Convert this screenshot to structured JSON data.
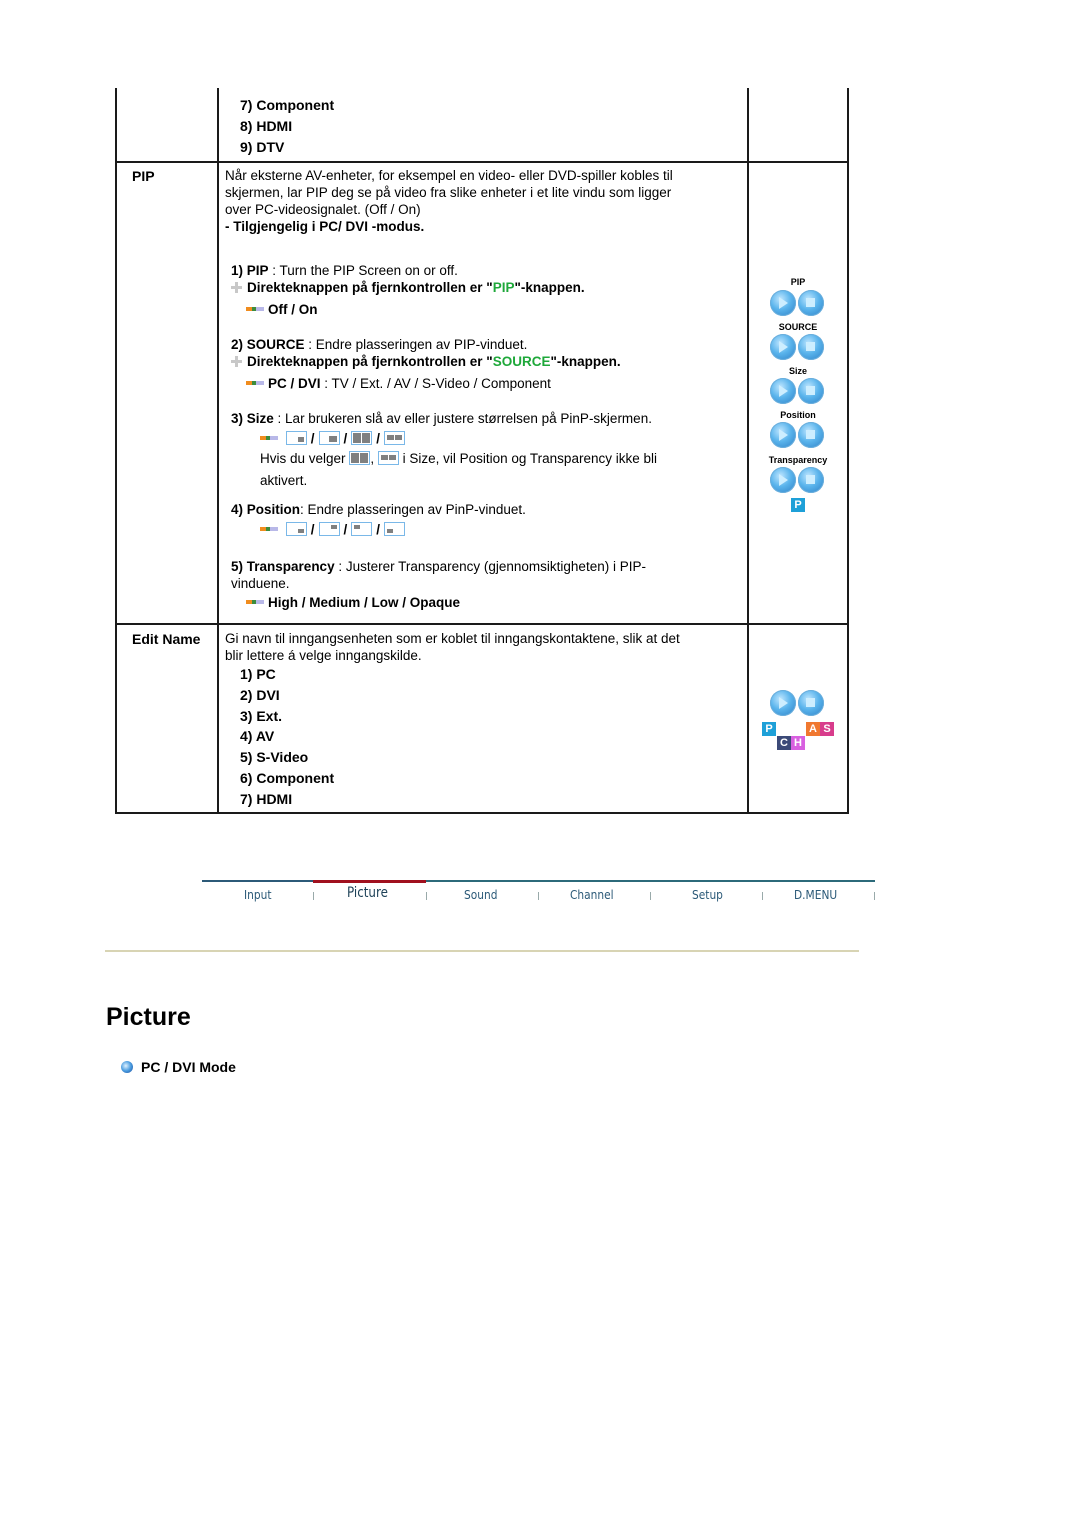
{
  "table": {
    "prev_items": [
      "7) Component",
      "8) HDMI",
      "9) DTV"
    ],
    "pip": {
      "label": "PIP",
      "desc_lines": [
        "Når eksterne AV-enheter, for eksempel en video- eller DVD-spiller kobles til",
        "skjermen, lar PIP deg se på video fra slike enheter i et lite vindu som ligger",
        "over PC-videosignalet. (Off / On)"
      ],
      "note": "- Tilgjengelig i PC/ DVI -modus.",
      "s1_num": "1)",
      "s1_key": "PIP",
      "s1_text": " : Turn the PIP Screen on or off.",
      "direct_pre": "Direkteknappen på fjernkontrollen er \"",
      "direct_pip_key": "PIP",
      "direct_post": "\"-knappen.",
      "s1_opts": "Off / On",
      "s2_num": "2)",
      "s2_key": "SOURCE",
      "s2_text": " : Endre plasseringen av PIP-vinduet.",
      "direct_source_key": "SOURCE",
      "s2_opts_key": "PC / DVI",
      "s2_opts_text": " : TV / Ext. / AV / S-Video / Component",
      "s3_num": "3)",
      "s3_key": "Size",
      "s3_text": " : Lar brukeren slå av eller justere størrelsen på PinP-skjermen.",
      "s3_note_pre": "Hvis du velger",
      "s3_note_comma": ",",
      "s3_note_post": "i Size, vil Position og Transparency ikke bli",
      "s3_note_line2": "aktivert.",
      "s4_num": "4)",
      "s4_key": "Position",
      "s4_text": ": Endre plasseringen av PinP-vinduet.",
      "s5_num": "5)",
      "s5_key": "Transparency",
      "s5_text": " : Justerer Transparency (gjennomsiktigheten) i PIP-",
      "s5_text2": "vinduene.",
      "s5_opts": "High / Medium / Low / Opaque",
      "slash": "/",
      "remote_labels": [
        "PIP",
        "SOURCE",
        "Size",
        "Position",
        "Transparency"
      ],
      "remote_p": "P"
    },
    "edit_name": {
      "label": "Edit Name",
      "desc_lines": [
        "Gi navn til inngangsenheten som er koblet til inngangskontaktene, slik at det",
        "blir lettere á velge inngangskilde."
      ],
      "items": [
        "1) PC",
        "2) DVI",
        "3) Ext.",
        "4) AV",
        "5) S-Video",
        "6) Component",
        "7) HDMI"
      ],
      "remote_keys": [
        "P",
        "A",
        "S",
        "C",
        "H"
      ]
    }
  },
  "nav": {
    "items": [
      "Input",
      "Picture",
      "Sound",
      "Channel",
      "Setup",
      "D.MENU"
    ],
    "active": "Picture",
    "colors": {
      "line": "#2c6a8a",
      "active_line": "#a0101e",
      "text": "#2c5a78"
    }
  },
  "page": {
    "title": "Picture",
    "section": "PC / DVI Mode"
  },
  "colors": {
    "highlight_green": "#1ea83a",
    "divider": "#d8d4b4"
  }
}
